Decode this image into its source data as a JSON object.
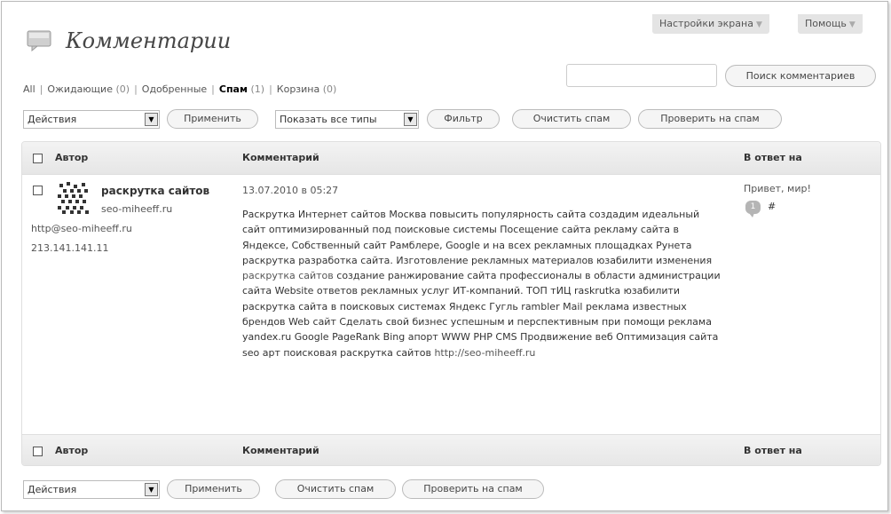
{
  "header": {
    "screen_options": "Настройки экрана",
    "help": "Помощь",
    "title": "Комментарии"
  },
  "filters": {
    "all": "All",
    "pending": "Ожидающие",
    "pending_count": "(0)",
    "approved": "Одобренные",
    "spam": "Спам",
    "spam_count": "(1)",
    "trash": "Корзина",
    "trash_count": "(0)"
  },
  "search": {
    "value": "",
    "button": "Поиск комментариев"
  },
  "toolbar_top": {
    "actions_select": "Действия",
    "apply": "Применить",
    "type_select": "Показать все типы",
    "filter": "Фильтр",
    "empty_spam": "Очистить спам",
    "check_spam": "Проверить на спам"
  },
  "columns": {
    "author": "Автор",
    "comment": "Комментарий",
    "response": "В ответ на"
  },
  "comment": {
    "author_name": "раскрутка сайтов",
    "author_site": "seo-miheeff.ru",
    "author_email": "http@seo-miheeff.ru",
    "author_ip": "213.141.141.11",
    "date": "13.07.2010 в 05:27",
    "text_1": "Раскрутка Интернет сайтов Москва повысить популярность сайта создадим идеальный сайт оптимизированный под поисковые системы Посещение сайта рекламу сайта в Яндексе, Собственный сайт Рамблере, Google и на всех рекламных площадках Рунета раскрутка разработка сайта. Изготовление рекламных материалов юзабилити изменения",
    "link_1": "раскрутка сайтов",
    "text_2": "создание ранжирование сайта профессионалы в области администрации сайта Website ответов рекламных услуг ИТ-компаний. ТОП тИЦ raskrutka юзабилити раскрутка сайта в поисковых системах Яндекс Гугль rambler Mail реклама известных брендов Web сайт Сделать свой бизнес успешным и перспективным при помощи реклама yandex.ru Google PageRank Bing апорт WWW PHP CMS Продвижение веб Оптимизация сайта seo арт поисковая раскрутка сайтов",
    "link_2": "http://seo-miheeff.ru",
    "reply_post": "Привет, мир!",
    "reply_count": "1",
    "hash": "#"
  },
  "toolbar_bottom": {
    "actions_select": "Действия",
    "apply": "Применить",
    "empty_spam": "Очистить спам",
    "check_spam": "Проверить на спам"
  }
}
